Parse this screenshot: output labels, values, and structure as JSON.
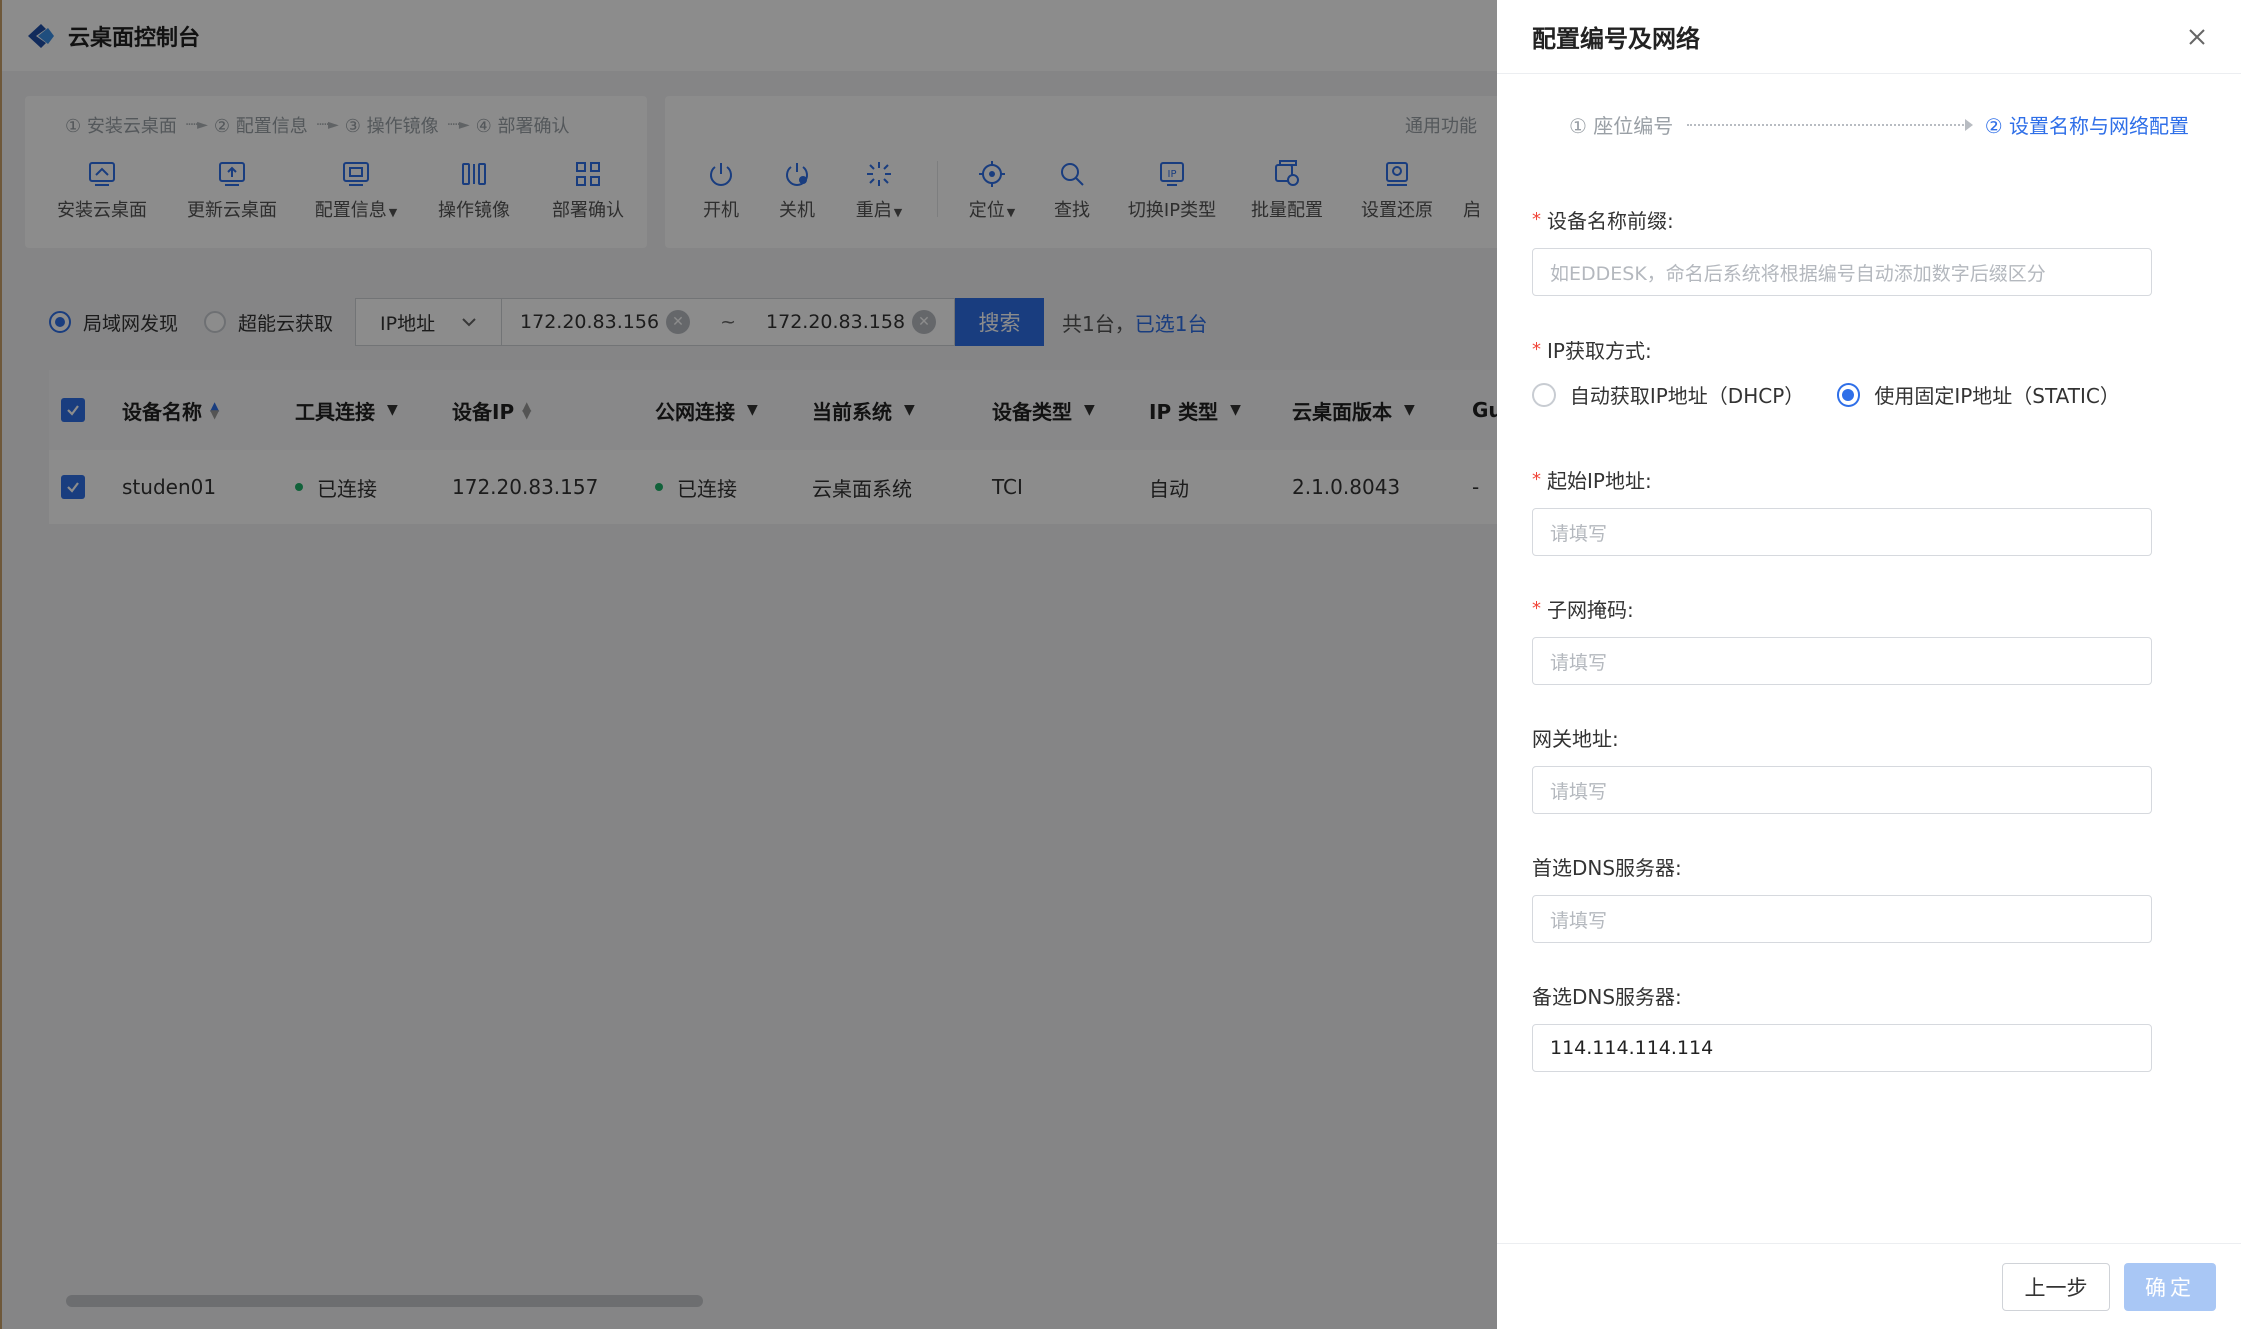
{
  "app": {
    "title": "云桌面控制台"
  },
  "deploy_steps": [
    "① 安装云桌面",
    "② 配置信息",
    "③ 操作镜像",
    "④ 部署确认"
  ],
  "deploy_tools": [
    {
      "label": "安装云桌面",
      "icon": "install-desktop-icon"
    },
    {
      "label": "更新云桌面",
      "icon": "update-desktop-icon"
    },
    {
      "label": "配置信息",
      "icon": "config-info-icon",
      "dropdown": true
    },
    {
      "label": "操作镜像",
      "icon": "mirror-icon"
    },
    {
      "label": "部署确认",
      "icon": "deploy-confirm-icon"
    }
  ],
  "common_functions_label": "通用功能",
  "common_tools": [
    {
      "label": "开机",
      "icon": "power-on-icon"
    },
    {
      "label": "关机",
      "icon": "shutdown-icon"
    },
    {
      "label": "重启",
      "icon": "restart-icon",
      "dropdown": true
    },
    {
      "label": "定位",
      "icon": "locate-icon",
      "dropdown": true
    },
    {
      "label": "查找",
      "icon": "search-icon"
    },
    {
      "label": "切换IP类型",
      "icon": "ip-switch-icon"
    },
    {
      "label": "批量配置",
      "icon": "batch-config-icon"
    },
    {
      "label": "设置还原",
      "icon": "restore-icon"
    },
    {
      "label": "启",
      "icon": "more-icon"
    }
  ],
  "filter": {
    "discover_mode_lan": "局域网发现",
    "discover_mode_cloud": "超能云获取",
    "ip_type_select": "IP地址",
    "ip_start": "172.20.83.156",
    "ip_sep": "~",
    "ip_end": "172.20.83.158",
    "search_label": "搜索",
    "count_text": "共1台，",
    "selected_text": "已选1台"
  },
  "table": {
    "columns": [
      "设备名称",
      "工具连接",
      "设备IP",
      "公网连接",
      "当前系统",
      "设备类型",
      "IP 类型",
      "云桌面版本",
      "Gu"
    ],
    "rows": [
      {
        "name": "studen01",
        "tool_conn": "已连接",
        "ip": "172.20.83.157",
        "public_conn": "已连接",
        "system": "云桌面系统",
        "type": "TCI",
        "ip_type": "自动",
        "version": "2.1.0.8043",
        "gu": "-"
      }
    ]
  },
  "drawer": {
    "title": "配置编号及网络",
    "step1": "① 座位编号",
    "step2": "② 设置名称与网络配置",
    "fields": {
      "prefix_label": "设备名称前缀:",
      "prefix_placeholder": "如EDDESK，命名后系统将根据编号自动添加数字后缀区分",
      "ip_mode_label": "IP获取方式:",
      "ip_mode_dhcp": "自动获取IP地址（DHCP）",
      "ip_mode_static": "使用固定IP地址（STATIC）",
      "ip_mode_selected": "static",
      "start_ip_label": "起始IP地址:",
      "start_ip_placeholder": "请填写",
      "subnet_label": "子网掩码:",
      "subnet_placeholder": "请填写",
      "gateway_label": "网关地址:",
      "gateway_placeholder": "请填写",
      "dns1_label": "首选DNS服务器:",
      "dns1_placeholder": "请填写",
      "dns2_label": "备选DNS服务器:",
      "dns2_value": "114.114.114.114"
    },
    "prev_label": "上一步",
    "ok_label": "确定"
  },
  "colors": {
    "accent": "#2f6fe8",
    "required": "#f04438",
    "connected": "#20b26b",
    "disabled_btn": "#a9c7f5"
  }
}
